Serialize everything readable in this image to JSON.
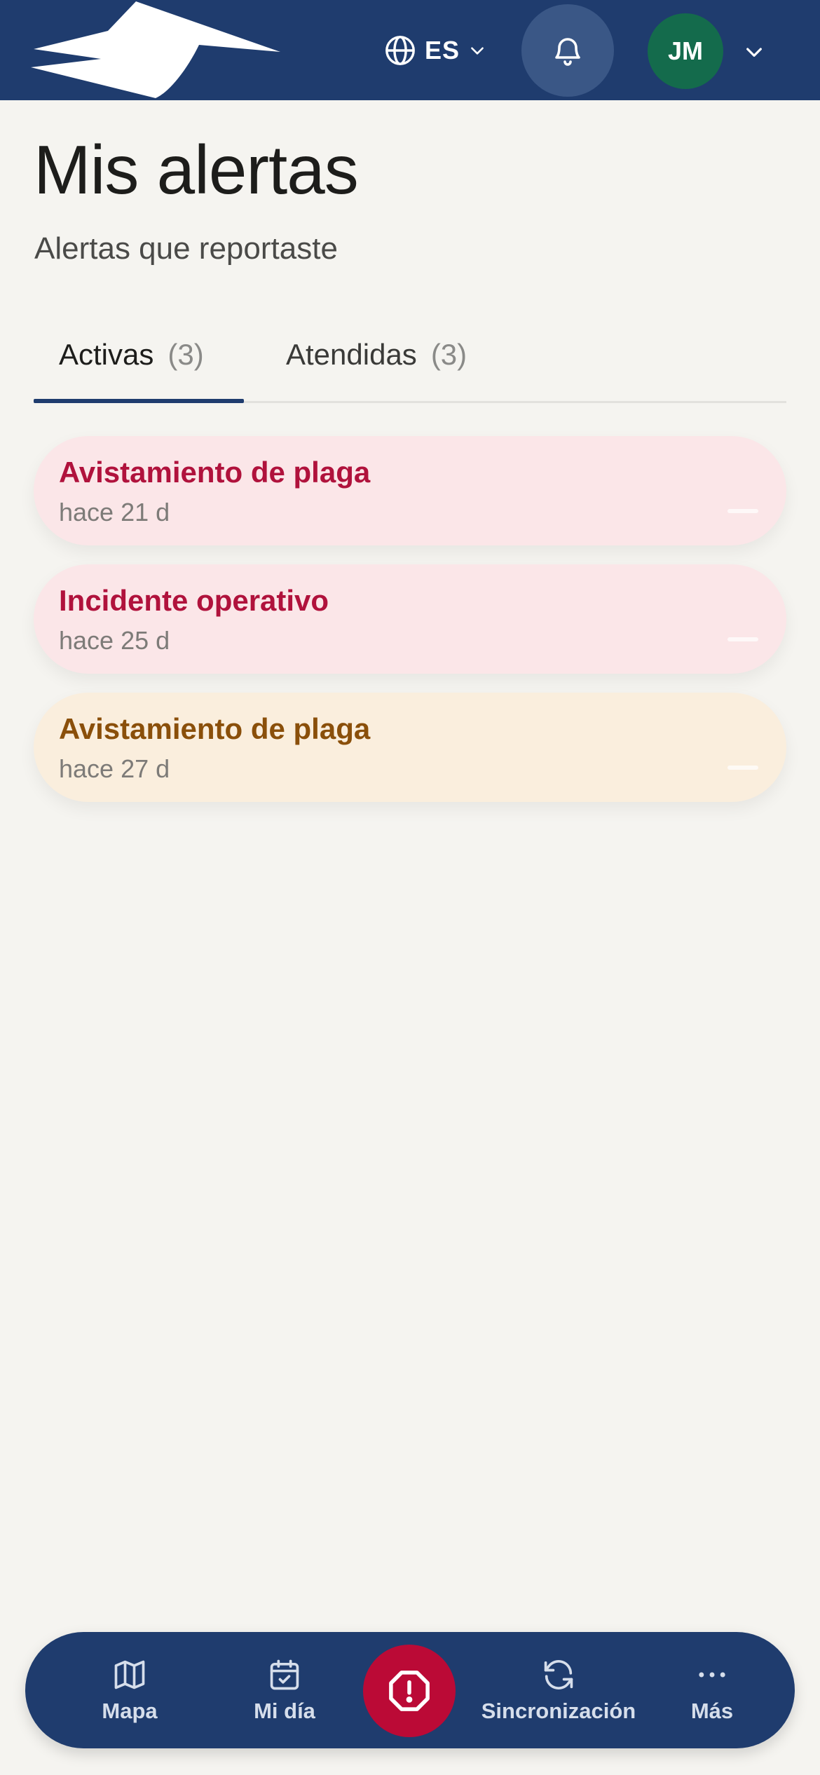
{
  "header": {
    "language": "ES",
    "user_initials": "JM",
    "colors": {
      "bar": "#1f3c6e",
      "avatar": "#146b4c",
      "bell_bg": "#3a5786"
    }
  },
  "page": {
    "title": "Mis alertas",
    "subtitle": "Alertas que reportaste"
  },
  "tabs": [
    {
      "label": "Activas",
      "count": "(3)",
      "active": true
    },
    {
      "label": "Atendidas",
      "count": "(3)",
      "active": false
    }
  ],
  "alerts": [
    {
      "title": "Avistamiento de plaga",
      "time": "hace 21 d",
      "title_color": "#b0123c",
      "bg_color": "#fbe6e8"
    },
    {
      "title": "Incidente operativo",
      "time": "hace 25 d",
      "title_color": "#b0123c",
      "bg_color": "#fbe6e8"
    },
    {
      "title": "Avistamiento de plaga",
      "time": "hace 27 d",
      "title_color": "#8a4f0a",
      "bg_color": "#faeedd"
    }
  ],
  "bottom_nav": {
    "items": [
      {
        "label": "Mapa",
        "icon": "map-icon"
      },
      {
        "label": "Mi día",
        "icon": "calendar-check-icon"
      },
      {
        "label": "Sincronización",
        "icon": "sync-icon"
      },
      {
        "label": "Más",
        "icon": "more-icon"
      }
    ],
    "sos_icon": "alert-octagon-icon",
    "sos_color": "#bb0a36"
  }
}
